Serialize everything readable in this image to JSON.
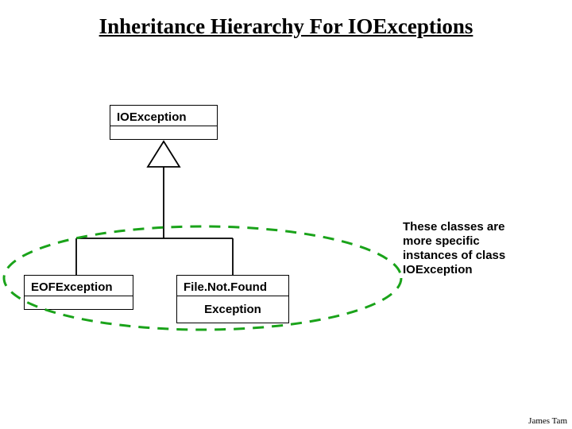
{
  "title": "Inheritance Hierarchy For IOExceptions",
  "nodes": {
    "parent": "IOException",
    "childLeft": "EOFException",
    "childRightLine1": "File.Not.Found",
    "childRightLine2": "Exception"
  },
  "annotation": {
    "line1": "These classes are",
    "line2": "more specific",
    "line3": "instances of class",
    "line4": "IOException"
  },
  "footer": "James Tam",
  "colors": {
    "ellipse": "#1aa31a"
  }
}
